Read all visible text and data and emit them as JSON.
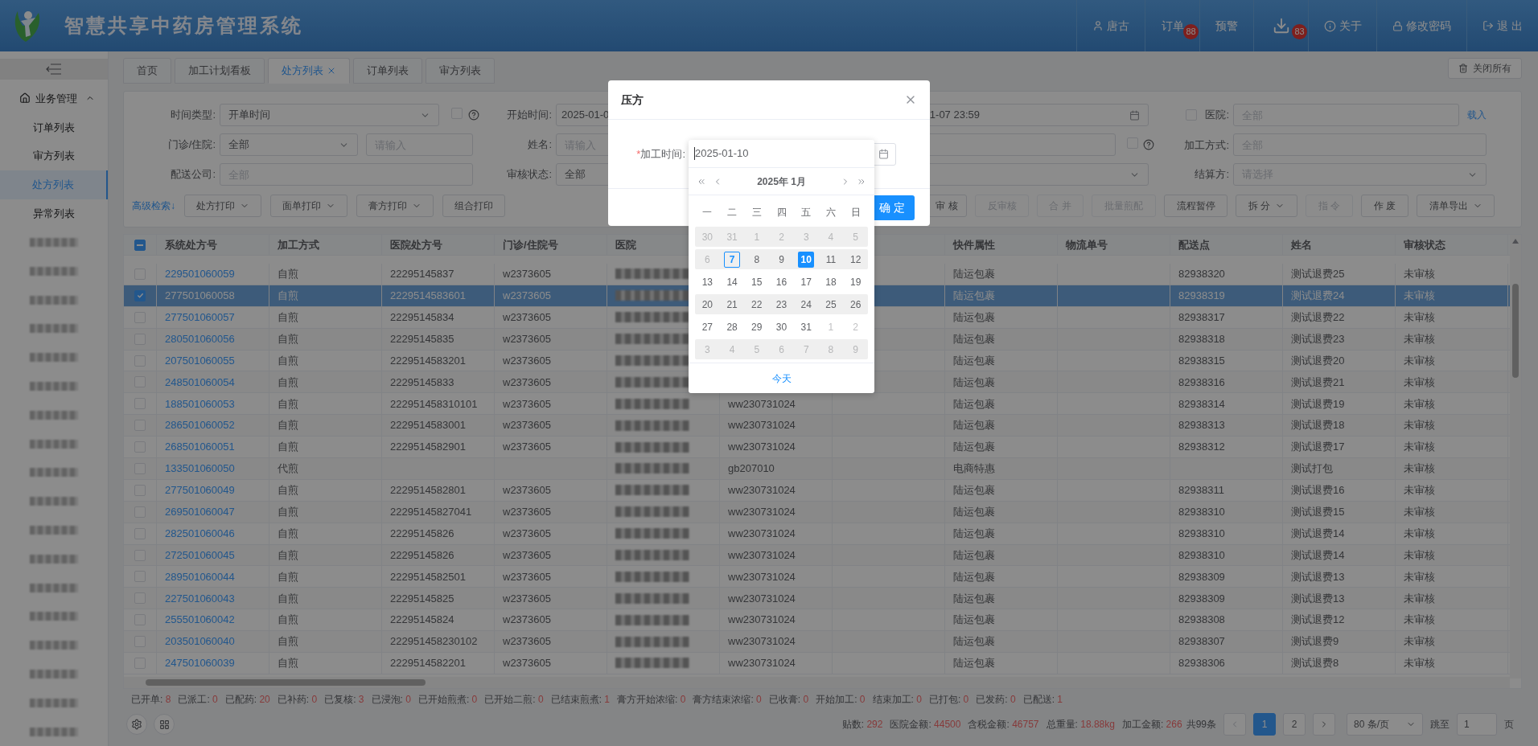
{
  "header": {
    "title": "智慧共享中药房管理系统",
    "nav": [
      {
        "kind": "user",
        "label": "唐古"
      },
      {
        "kind": "orders",
        "label": "订单",
        "badge": "88"
      },
      {
        "kind": "warning",
        "label": "预警"
      },
      {
        "kind": "download",
        "badge": "83"
      },
      {
        "kind": "about",
        "label": "关于"
      },
      {
        "kind": "password",
        "label": "修改密码"
      },
      {
        "kind": "logout",
        "label": "退 出"
      }
    ]
  },
  "sidebar": {
    "group": {
      "label": "业务管理",
      "expanded": true
    },
    "items": [
      {
        "kind": "text",
        "label": "订单列表",
        "selected": false
      },
      {
        "kind": "text",
        "label": "审方列表",
        "selected": false
      },
      {
        "kind": "text",
        "label": "处方列表",
        "selected": true
      },
      {
        "kind": "text",
        "label": "异常列表",
        "selected": false
      },
      {
        "kind": "blurred",
        "selected": false
      },
      {
        "kind": "blurred",
        "selected": false
      },
      {
        "kind": "blurred",
        "selected": false
      },
      {
        "kind": "blurred",
        "selected": false
      },
      {
        "kind": "blurred",
        "selected": false
      },
      {
        "kind": "blurred",
        "selected": false
      },
      {
        "kind": "blurred",
        "selected": false
      },
      {
        "kind": "blurred",
        "selected": false
      },
      {
        "kind": "blurred",
        "selected": false
      },
      {
        "kind": "blurred",
        "selected": false
      },
      {
        "kind": "blurred",
        "selected": false
      },
      {
        "kind": "blurred",
        "selected": false
      },
      {
        "kind": "blurred",
        "selected": false
      },
      {
        "kind": "blurred",
        "selected": false
      },
      {
        "kind": "blurred",
        "selected": false
      },
      {
        "kind": "blurred",
        "selected": false
      },
      {
        "kind": "blurred",
        "selected": false
      },
      {
        "kind": "blurred",
        "selected": false
      }
    ]
  },
  "tabs": [
    {
      "label": "首页",
      "selected": false,
      "closable": false
    },
    {
      "label": "加工计划看板",
      "selected": false,
      "closable": false
    },
    {
      "label": "处方列表",
      "selected": true,
      "closable": true
    },
    {
      "label": "订单列表",
      "selected": false,
      "closable": false
    },
    {
      "label": "审方列表",
      "selected": false,
      "closable": false
    }
  ],
  "close_all": "关闭所有",
  "filters": {
    "time_type": {
      "label": "时间类型:",
      "value": "开单时间",
      "checked": false
    },
    "start_time": {
      "label": "开始时间:",
      "start": "2025-01-0",
      "end": "1-07 23:59"
    },
    "hospital": {
      "label": "医院:",
      "placeholder": "全部",
      "checked": false,
      "link": "载入"
    },
    "visit": {
      "label": "门诊/住院:",
      "value": "全部",
      "placeholder": "请输入"
    },
    "name": {
      "label": "姓名:",
      "placeholder": "请输入",
      "checked": false
    },
    "process": {
      "label": "加工方式:",
      "placeholder": "全部"
    },
    "company": {
      "label": "配送公司:",
      "placeholder": "全部"
    },
    "audit": {
      "label": "审核状态:",
      "value": "全部"
    },
    "settlement": {
      "label": "结算方:",
      "placeholder": "请选择"
    }
  },
  "toolbar_left": [
    {
      "kind": "link",
      "label": "高级检索↓",
      "disabled": false
    },
    {
      "kind": "dropdown",
      "label": "处方打印",
      "disabled": false
    },
    {
      "kind": "dropdown",
      "label": "面单打印",
      "disabled": false
    },
    {
      "kind": "dropdown",
      "label": "膏方打印",
      "disabled": false
    },
    {
      "kind": "plain",
      "label": "组合打印",
      "disabled": false
    }
  ],
  "toolbar_right": [
    {
      "kind": "plain",
      "label": "审 核",
      "disabled": false
    },
    {
      "kind": "plain",
      "label": "反审核",
      "disabled": true
    },
    {
      "kind": "plain",
      "label": "合 并",
      "disabled": true
    },
    {
      "kind": "plain",
      "label": "批量煎配",
      "disabled": true
    },
    {
      "kind": "plain",
      "label": "流程暂停",
      "disabled": false
    },
    {
      "kind": "dropdown",
      "label": "拆 分",
      "disabled": false
    },
    {
      "kind": "plain",
      "label": "指 令",
      "disabled": true
    },
    {
      "kind": "plain",
      "label": "作 废",
      "disabled": false
    },
    {
      "kind": "dropdown",
      "label": "清单导出",
      "disabled": false
    }
  ],
  "table": {
    "select_all_indeterminate": true,
    "columns": [
      "系统处方号",
      "加工方式",
      "医院处方号",
      "门诊/住院号",
      "医院",
      null,
      null,
      "快件属性",
      "物流单号",
      "配送点",
      "姓名",
      "审核状态"
    ],
    "rows": [
      {
        "selected": false,
        "checked": false,
        "cells": [
          "229501060059",
          "自煎",
          "22295145837",
          "w2373605",
          {
            "kind": "blurred"
          },
          null,
          null,
          "陆运包裹",
          null,
          "82938320",
          "测试退费25",
          "未审核"
        ]
      },
      {
        "selected": true,
        "checked": true,
        "cells": [
          "277501060058",
          "自煎",
          "2229514583601",
          "w2373605",
          {
            "kind": "blurred"
          },
          null,
          null,
          "陆运包裹",
          null,
          "82938319",
          "测试退费24",
          "未审核"
        ]
      },
      {
        "selected": false,
        "checked": false,
        "cells": [
          "277501060057",
          "自煎",
          "22295145834",
          "w2373605",
          {
            "kind": "blurred"
          },
          null,
          null,
          "陆运包裹",
          null,
          "82938317",
          "测试退费22",
          "未审核"
        ]
      },
      {
        "selected": false,
        "checked": false,
        "cells": [
          "280501060056",
          "自煎",
          "22295145835",
          "w2373605",
          {
            "kind": "blurred"
          },
          null,
          null,
          "陆运包裹",
          null,
          "82938318",
          "测试退费23",
          "未审核"
        ]
      },
      {
        "selected": false,
        "checked": false,
        "cells": [
          "207501060055",
          "自煎",
          "2229514583201",
          "w2373605",
          {
            "kind": "blurred"
          },
          null,
          null,
          "陆运包裹",
          null,
          "82938315",
          "测试退费20",
          "未审核"
        ]
      },
      {
        "selected": false,
        "checked": false,
        "cells": [
          "248501060054",
          "自煎",
          "22295145833",
          "w2373605",
          {
            "kind": "blurred"
          },
          null,
          null,
          "陆运包裹",
          null,
          "82938316",
          "测试退费21",
          "未审核"
        ]
      },
      {
        "selected": false,
        "checked": false,
        "cells": [
          "188501060053",
          "自煎",
          "222951458310101",
          "w2373605",
          {
            "kind": "blurred"
          },
          "ww230731024",
          null,
          "陆运包裹",
          null,
          "82938314",
          "测试退费19",
          "未审核"
        ]
      },
      {
        "selected": false,
        "checked": false,
        "cells": [
          "286501060052",
          "自煎",
          "2229514583001",
          "w2373605",
          {
            "kind": "blurred"
          },
          "ww230731024",
          null,
          "陆运包裹",
          null,
          "82938313",
          "测试退费18",
          "未审核"
        ]
      },
      {
        "selected": false,
        "checked": false,
        "cells": [
          "268501060051",
          "自煎",
          "2229514582901",
          "w2373605",
          {
            "kind": "blurred"
          },
          "ww230731024",
          null,
          "陆运包裹",
          null,
          "82938312",
          "测试退费17",
          "未审核"
        ]
      },
      {
        "selected": false,
        "checked": false,
        "cells": [
          "133501060050",
          "代煎",
          null,
          null,
          {
            "kind": "blurred"
          },
          "gb207010",
          null,
          "电商特惠",
          null,
          null,
          "测试打包",
          "未审核"
        ]
      },
      {
        "selected": false,
        "checked": false,
        "cells": [
          "277501060049",
          "自煎",
          "2229514582801",
          "w2373605",
          {
            "kind": "blurred"
          },
          "ww230731024",
          null,
          "陆运包裹",
          null,
          "82938311",
          "测试退费16",
          "未审核"
        ]
      },
      {
        "selected": false,
        "checked": false,
        "cells": [
          "269501060047",
          "自煎",
          "22295145827041",
          "w2373605",
          {
            "kind": "blurred"
          },
          "ww230731024",
          null,
          "陆运包裹",
          null,
          "82938310",
          "测试退费15",
          "未审核"
        ]
      },
      {
        "selected": false,
        "checked": false,
        "cells": [
          "282501060046",
          "自煎",
          "22295145826",
          "w2373605",
          {
            "kind": "blurred"
          },
          "ww230731024",
          null,
          "陆运包裹",
          null,
          "82938310",
          "测试退费14",
          "未审核"
        ]
      },
      {
        "selected": false,
        "checked": false,
        "cells": [
          "272501060045",
          "自煎",
          "22295145826",
          "w2373605",
          {
            "kind": "blurred"
          },
          "ww230731024",
          null,
          "陆运包裹",
          null,
          "82938310",
          "测试退费14",
          "未审核"
        ]
      },
      {
        "selected": false,
        "checked": false,
        "cells": [
          "289501060044",
          "自煎",
          "2229514582501",
          "w2373605",
          {
            "kind": "blurred"
          },
          "ww230731024",
          null,
          "陆运包裹",
          null,
          "82938309",
          "测试退费13",
          "未审核"
        ]
      },
      {
        "selected": false,
        "checked": false,
        "cells": [
          "227501060043",
          "自煎",
          "22295145825",
          "w2373605",
          {
            "kind": "blurred"
          },
          "ww230731024",
          null,
          "陆运包裹",
          null,
          "82938309",
          "测试退费13",
          "未审核"
        ]
      },
      {
        "selected": false,
        "checked": false,
        "cells": [
          "255501060042",
          "自煎",
          "22295145824",
          "w2373605",
          {
            "kind": "blurred"
          },
          "ww230731024",
          null,
          "陆运包裹",
          null,
          "82938308",
          "测试退费12",
          "未审核"
        ]
      },
      {
        "selected": false,
        "checked": false,
        "cells": [
          "203501060040",
          "自煎",
          "222951458230102",
          "w2373605",
          {
            "kind": "blurred"
          },
          "ww230731024",
          null,
          "陆运包裹",
          null,
          "82938307",
          "测试退费9",
          "未审核"
        ]
      },
      {
        "selected": false,
        "checked": false,
        "cells": [
          "247501060039",
          "自煎",
          "2229514582201",
          "w2373605",
          {
            "kind": "blurred"
          },
          "ww230731024",
          null,
          "陆运包裹",
          null,
          "82938306",
          "测试退费8",
          "未审核"
        ]
      }
    ]
  },
  "stats": [
    {
      "label": "已开单:",
      "value": "8"
    },
    {
      "label": "已派工:",
      "value": "0"
    },
    {
      "label": "已配药:",
      "value": "20"
    },
    {
      "label": "已补药:",
      "value": "0"
    },
    {
      "label": "已复核:",
      "value": "3"
    },
    {
      "label": "已浸泡:",
      "value": "0"
    },
    {
      "label": "已开始煎煮:",
      "value": "0"
    },
    {
      "label": "已开始二煎:",
      "value": "0"
    },
    {
      "label": "已结束煎煮:",
      "value": "1"
    },
    {
      "label": "膏方开始浓缩:",
      "value": "0"
    },
    {
      "label": "膏方结束浓缩:",
      "value": "0"
    },
    {
      "label": "已收膏:",
      "value": "0"
    },
    {
      "label": "开始加工:",
      "value": "0"
    },
    {
      "label": "结束加工:",
      "value": "0"
    },
    {
      "label": "已打包:",
      "value": "0"
    },
    {
      "label": "已发药:",
      "value": "0"
    },
    {
      "label": "已配送:",
      "value": "1"
    }
  ],
  "summary": [
    {
      "label": "贴数:",
      "value": "292"
    },
    {
      "label": "医院金额:",
      "value": "44500"
    },
    {
      "label": "含税金额:",
      "value": "46757"
    },
    {
      "label": "总重量:",
      "value": "18.88kg"
    },
    {
      "label": "加工金额:",
      "value": "266"
    }
  ],
  "pagination": {
    "total": "共99条",
    "pages": [
      {
        "label": "1",
        "selected": true
      },
      {
        "label": "2",
        "selected": false
      }
    ],
    "page_size": "80 条/页",
    "jump_label": "跳至",
    "jump_value": "1",
    "jump_suffix": "页"
  },
  "modal": {
    "title": "压方",
    "field": {
      "required_mark": "*",
      "label": "加工时间:",
      "value": "2025-01-10"
    },
    "confirm": "确 定",
    "calendar": {
      "title": "2025年 1月",
      "weekdays": [
        "一",
        "二",
        "三",
        "四",
        "五",
        "六",
        "日"
      ],
      "today_link": "今天",
      "weeks": [
        {
          "shaded": true,
          "days": [
            {
              "d": "30",
              "muted": true,
              "today": false,
              "selected": false
            },
            {
              "d": "31",
              "muted": true,
              "today": false,
              "selected": false
            },
            {
              "d": "1",
              "muted": true,
              "today": false,
              "selected": false
            },
            {
              "d": "2",
              "muted": true,
              "today": false,
              "selected": false
            },
            {
              "d": "3",
              "muted": true,
              "today": false,
              "selected": false
            },
            {
              "d": "4",
              "muted": true,
              "today": false,
              "selected": false
            },
            {
              "d": "5",
              "muted": true,
              "today": false,
              "selected": false
            }
          ]
        },
        {
          "shaded": true,
          "days": [
            {
              "d": "6",
              "muted": true,
              "today": false,
              "selected": false
            },
            {
              "d": "7",
              "muted": false,
              "today": true,
              "selected": false
            },
            {
              "d": "8",
              "muted": false,
              "today": false,
              "selected": false
            },
            {
              "d": "9",
              "muted": false,
              "today": false,
              "selected": false
            },
            {
              "d": "10",
              "muted": false,
              "today": false,
              "selected": true
            },
            {
              "d": "11",
              "muted": false,
              "today": false,
              "selected": false
            },
            {
              "d": "12",
              "muted": false,
              "today": false,
              "selected": false
            }
          ]
        },
        {
          "shaded": false,
          "days": [
            {
              "d": "13",
              "muted": false,
              "today": false,
              "selected": false
            },
            {
              "d": "14",
              "muted": false,
              "today": false,
              "selected": false
            },
            {
              "d": "15",
              "muted": false,
              "today": false,
              "selected": false
            },
            {
              "d": "16",
              "muted": false,
              "today": false,
              "selected": false
            },
            {
              "d": "17",
              "muted": false,
              "today": false,
              "selected": false
            },
            {
              "d": "18",
              "muted": false,
              "today": false,
              "selected": false
            },
            {
              "d": "19",
              "muted": false,
              "today": false,
              "selected": false
            }
          ]
        },
        {
          "shaded": true,
          "days": [
            {
              "d": "20",
              "muted": false,
              "today": false,
              "selected": false
            },
            {
              "d": "21",
              "muted": false,
              "today": false,
              "selected": false
            },
            {
              "d": "22",
              "muted": false,
              "today": false,
              "selected": false
            },
            {
              "d": "23",
              "muted": false,
              "today": false,
              "selected": false
            },
            {
              "d": "24",
              "muted": false,
              "today": false,
              "selected": false
            },
            {
              "d": "25",
              "muted": false,
              "today": false,
              "selected": false
            },
            {
              "d": "26",
              "muted": false,
              "today": false,
              "selected": false
            }
          ]
        },
        {
          "shaded": false,
          "days": [
            {
              "d": "27",
              "muted": false,
              "today": false,
              "selected": false
            },
            {
              "d": "28",
              "muted": false,
              "today": false,
              "selected": false
            },
            {
              "d": "29",
              "muted": false,
              "today": false,
              "selected": false
            },
            {
              "d": "30",
              "muted": false,
              "today": false,
              "selected": false
            },
            {
              "d": "31",
              "muted": false,
              "today": false,
              "selected": false
            },
            {
              "d": "1",
              "muted": true,
              "today": false,
              "selected": false
            },
            {
              "d": "2",
              "muted": true,
              "today": false,
              "selected": false
            }
          ]
        },
        {
          "shaded": true,
          "days": [
            {
              "d": "3",
              "muted": true,
              "today": false,
              "selected": false
            },
            {
              "d": "4",
              "muted": true,
              "today": false,
              "selected": false
            },
            {
              "d": "5",
              "muted": true,
              "today": false,
              "selected": false
            },
            {
              "d": "6",
              "muted": true,
              "today": false,
              "selected": false
            },
            {
              "d": "7",
              "muted": true,
              "today": false,
              "selected": false
            },
            {
              "d": "8",
              "muted": true,
              "today": false,
              "selected": false
            },
            {
              "d": "9",
              "muted": true,
              "today": false,
              "selected": false
            }
          ]
        }
      ]
    }
  }
}
